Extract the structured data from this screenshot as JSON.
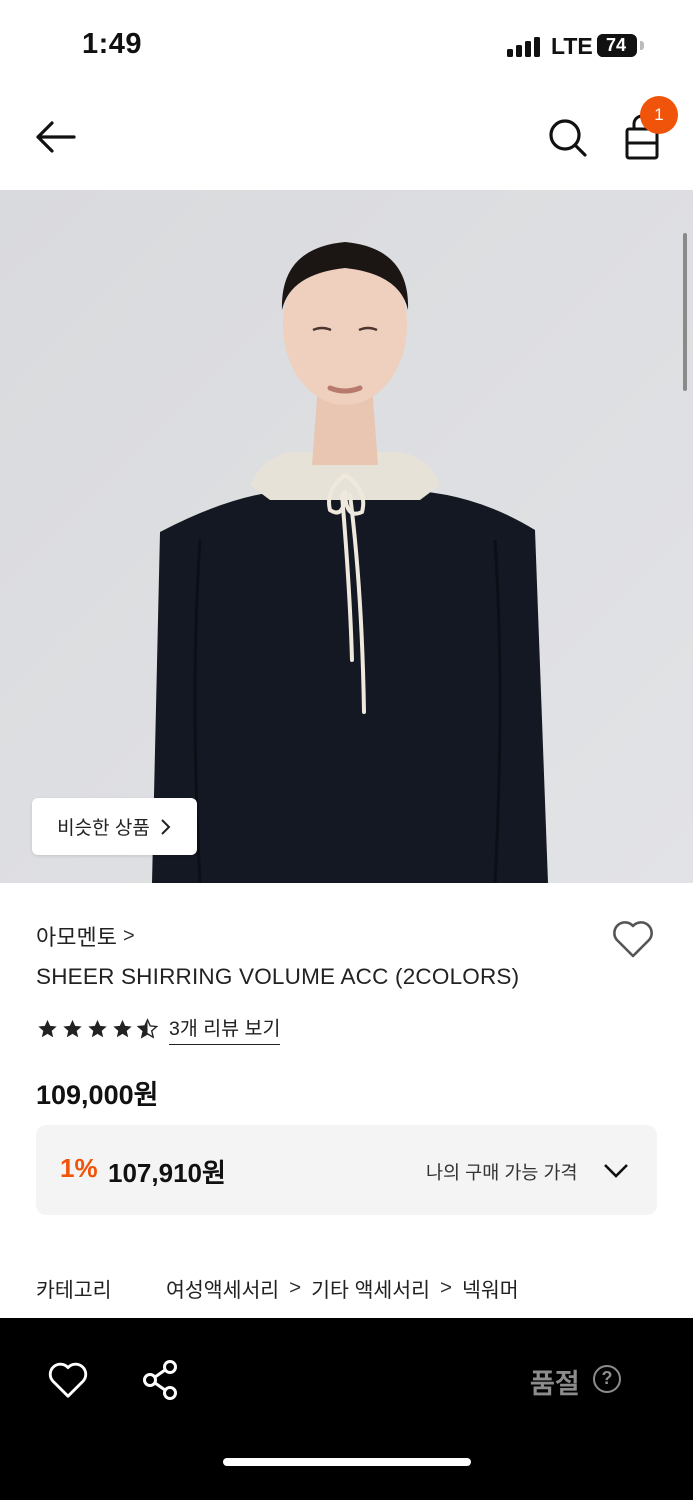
{
  "status_bar": {
    "time": "1:49",
    "network": "LTE",
    "battery": "74",
    "battery_level": 0.74
  },
  "header": {
    "back_icon": "arrow-left-icon",
    "search_icon": "search-icon",
    "cart_icon": "shopping-bag-icon",
    "cart_count": "1"
  },
  "hero": {
    "similar_button": {
      "label": "비슷한 상품",
      "icon": "chevron-right-icon"
    }
  },
  "product": {
    "brand": "아모멘토",
    "brand_chevron": ">",
    "title": "SHEER SHIRRING VOLUME ACC (2COLORS)",
    "rating": 4.5,
    "review_link": "3개 리뷰 보기",
    "price": "109,000원",
    "discount": {
      "rate": "1%",
      "price": "107,910원",
      "label": "나의 구매 가능 가격"
    },
    "category": {
      "label": "카테고리",
      "path": [
        "여성액세서리",
        "기타 액세서리",
        "넥워머"
      ],
      "separator": ">"
    }
  },
  "bottom_bar": {
    "status": "품절",
    "help": "?",
    "like_icon": "heart-icon",
    "share_icon": "share-icon"
  },
  "colors": {
    "accent": "#f0540a",
    "bottom_bar_bg": "#000000",
    "soldout_text": "#8c8c8c",
    "price_box_bg": "#f4f4f4"
  }
}
